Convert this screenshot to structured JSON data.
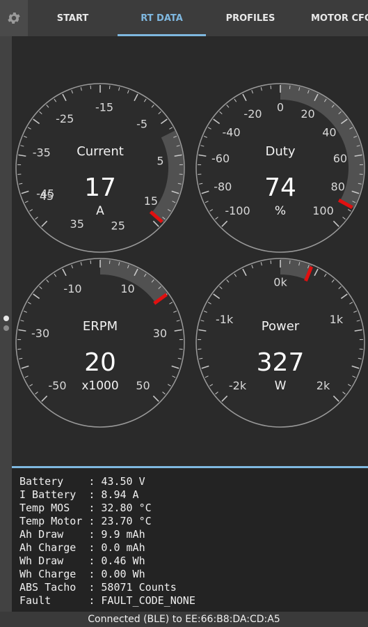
{
  "tabs": [
    {
      "label": "START"
    },
    {
      "label": "RT DATA"
    },
    {
      "label": "PROFILES"
    },
    {
      "label": "MOTOR CFG"
    }
  ],
  "active_tab": "RT DATA",
  "accent_color": "#7fb8e0",
  "needle_color": "#e01010",
  "gauges": [
    {
      "title": "Current",
      "value": "17",
      "unit": "A",
      "min": -50,
      "max": 18,
      "needle": 17,
      "tick_labels": [
        {
          "label": "-45",
          "v": -45
        },
        {
          "label": "-35",
          "v": -35
        },
        {
          "label": "-25",
          "v": -25
        },
        {
          "label": "-15",
          "v": -15
        },
        {
          "label": "-5",
          "v": -5
        },
        {
          "label": "5",
          "v": 5
        },
        {
          "label": "15",
          "v": 15
        },
        {
          "label": "25",
          "v": 25
        },
        {
          "label": "35",
          "v": 35
        },
        {
          "label": "45",
          "v": 45
        }
      ]
    },
    {
      "title": "Duty",
      "value": "74",
      "unit": "%",
      "min": -100,
      "max": 100,
      "needle": 88,
      "tick_labels": [
        {
          "label": "-100",
          "v": -100
        },
        {
          "label": "-80",
          "v": -80
        },
        {
          "label": "-60",
          "v": -60
        },
        {
          "label": "-40",
          "v": -40
        },
        {
          "label": "-20",
          "v": -20
        },
        {
          "label": "0",
          "v": 0
        },
        {
          "label": "20",
          "v": 20
        },
        {
          "label": "40",
          "v": 40
        },
        {
          "label": "60",
          "v": 60
        },
        {
          "label": "80",
          "v": 80
        },
        {
          "label": "100",
          "v": 100
        }
      ]
    },
    {
      "title": "ERPM",
      "value": "20",
      "unit": "x1000",
      "min": -50,
      "max": 50,
      "needle": 20,
      "tick_labels": [
        {
          "label": "-50",
          "v": -50
        },
        {
          "label": "-30",
          "v": -30
        },
        {
          "label": "-10",
          "v": -10
        },
        {
          "label": "10",
          "v": 10
        },
        {
          "label": "30",
          "v": 30
        },
        {
          "label": "50",
          "v": 50
        }
      ]
    },
    {
      "title": "Power",
      "value": "327",
      "unit": "W",
      "min": -2,
      "max": 2,
      "needle": 0.33,
      "tick_labels": [
        {
          "label": "-2k",
          "v": -2
        },
        {
          "label": "-1k",
          "v": -1
        },
        {
          "label": "0k",
          "v": 0
        },
        {
          "label": "1k",
          "v": 1
        },
        {
          "label": "2k",
          "v": 2
        }
      ]
    }
  ],
  "info_rows": [
    "Battery    : 43.50 V",
    "I Battery  : 8.94 A",
    "Temp MOS   : 32.80 °C",
    "Temp Motor : 23.70 °C",
    "Ah Draw    : 9.9 mAh",
    "Ah Charge  : 0.0 mAh",
    "Wh Draw    : 0.46 Wh",
    "Wh Charge  : 0.00 Wh",
    "ABS Tacho  : 58071 Counts",
    "Fault      : FAULT_CODE_NONE"
  ],
  "status": "Connected (BLE) to EE:66:B8:DA:CD:A5"
}
